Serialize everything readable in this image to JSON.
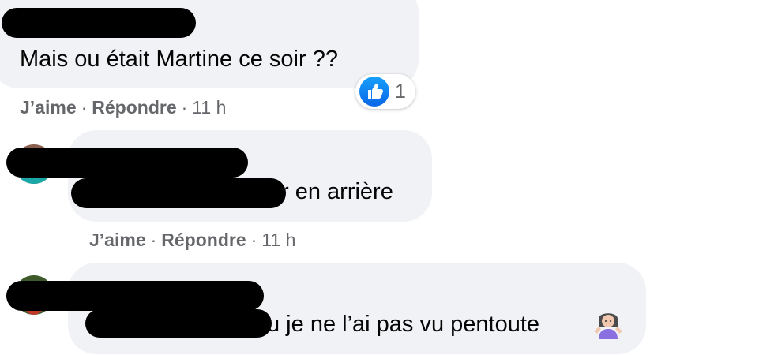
{
  "comments": [
    {
      "text": "Mais ou était Martine ce soir ??",
      "reaction": {
        "icon": "like-icon",
        "count": "1"
      },
      "actions": {
        "like": "J’aime",
        "reply": "Répondre",
        "time": "11 h"
      }
    },
    {
      "text": "r en arrière",
      "actions": {
        "like": "J’aime",
        "reply": "Répondre",
        "time": "11 h"
      }
    },
    {
      "text": "u je ne l’ai pas vu pentoute",
      "emoji": "woman-shrugging-emoji"
    }
  ],
  "separator": "·",
  "colors": {
    "bubble": "#f0f2f5",
    "text": "#050505",
    "meta": "#65676b",
    "like_blue": "#1877f2"
  }
}
